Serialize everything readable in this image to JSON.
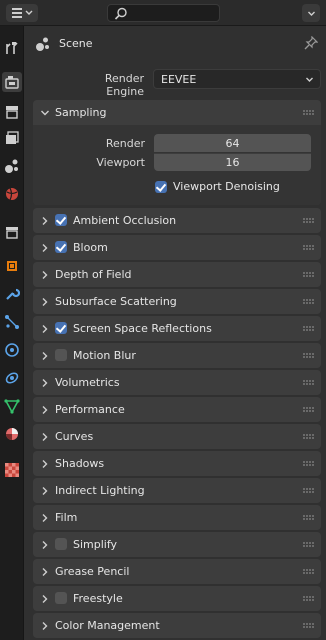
{
  "header": {
    "search_placeholder": ""
  },
  "context": {
    "label": "Scene"
  },
  "render_engine": {
    "label": "Render Engine",
    "value": "EEVEE"
  },
  "sampling": {
    "title": "Sampling",
    "expanded": true,
    "render_label": "Render",
    "render_value": "64",
    "viewport_label": "Viewport",
    "viewport_value": "16",
    "denoise_label": "Viewport Denoising",
    "denoise_checked": true
  },
  "panels": [
    {
      "title": "Ambient Occlusion",
      "checkbox": "on"
    },
    {
      "title": "Bloom",
      "checkbox": "on"
    },
    {
      "title": "Depth of Field",
      "checkbox": "none"
    },
    {
      "title": "Subsurface Scattering",
      "checkbox": "none"
    },
    {
      "title": "Screen Space Reflections",
      "checkbox": "on"
    },
    {
      "title": "Motion Blur",
      "checkbox": "off"
    },
    {
      "title": "Volumetrics",
      "checkbox": "none"
    },
    {
      "title": "Performance",
      "checkbox": "none"
    },
    {
      "title": "Curves",
      "checkbox": "none"
    },
    {
      "title": "Shadows",
      "checkbox": "none"
    },
    {
      "title": "Indirect Lighting",
      "checkbox": "none"
    },
    {
      "title": "Film",
      "checkbox": "none"
    },
    {
      "title": "Simplify",
      "checkbox": "off"
    },
    {
      "title": "Grease Pencil",
      "checkbox": "none"
    },
    {
      "title": "Freestyle",
      "checkbox": "off"
    },
    {
      "title": "Color Management",
      "checkbox": "none"
    }
  ],
  "colors": {
    "accent": "#4772b3",
    "panel": "#3d3d3d",
    "background": "#303030"
  }
}
